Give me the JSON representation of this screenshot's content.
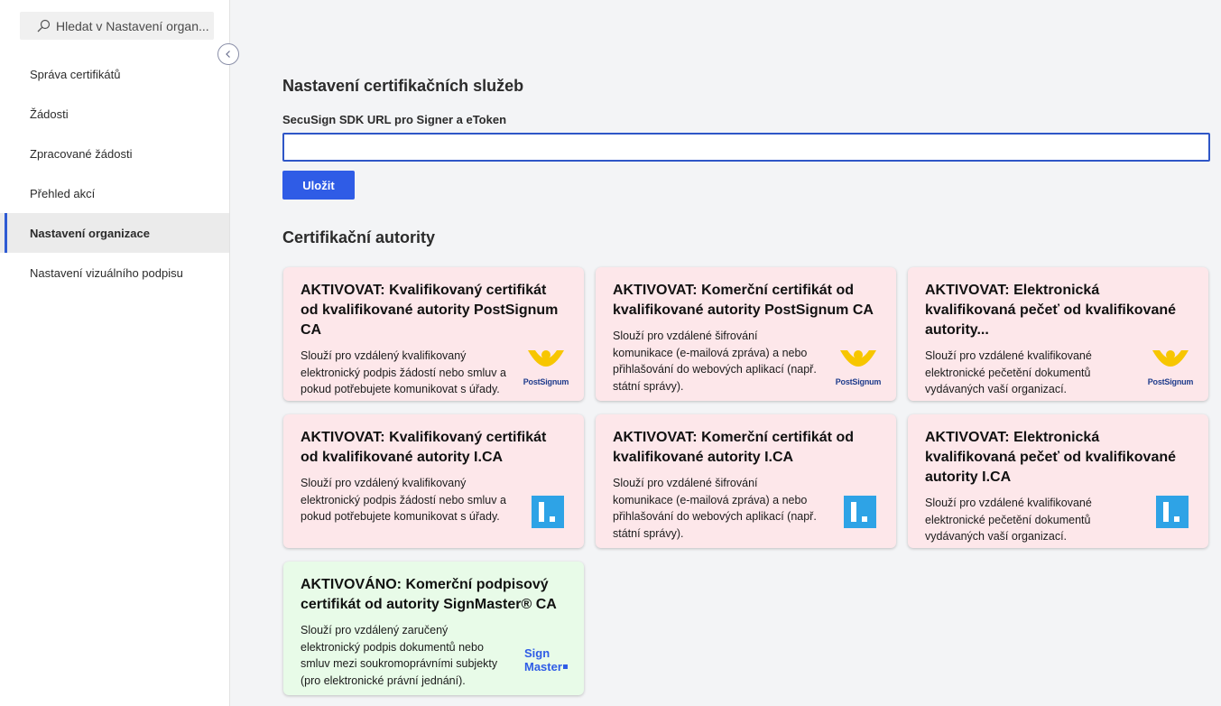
{
  "search": {
    "placeholder": "Hledat v Nastavení organ..."
  },
  "sidebar": {
    "items": [
      {
        "label": "Správa certifikátů"
      },
      {
        "label": "Žádosti"
      },
      {
        "label": "Zpracované žádosti"
      },
      {
        "label": "Přehled akcí"
      },
      {
        "label": "Nastavení organizace",
        "active": true
      },
      {
        "label": "Nastavení vizuálního podpisu"
      }
    ]
  },
  "main": {
    "services_title": "Nastavení certifikačních služeb",
    "url_label": "SecuSign SDK URL pro Signer a eToken",
    "url_value": "",
    "save_label": "Uložit",
    "authorities_title": "Certifikační autority"
  },
  "cards": [
    {
      "title": "AKTIVOVAT: Kvalifikovaný certifikát od kvalifikované autority PostSignum CA",
      "desc": "Slouží pro vzdálený kvalifikovaný elektronický podpis žádostí nebo smluv a pokud potřebujete komunikovat s úřady.",
      "logo": "PostSignum",
      "status": "inactive"
    },
    {
      "title": "AKTIVOVAT: Komerční certifikát od kvalifikované autority PostSignum CA",
      "desc": "Slouží pro vzdálené šifrování komunikace (e-mailová zpráva) a nebo přihlašování do webových aplikací (např. státní správy).",
      "logo": "PostSignum",
      "status": "inactive"
    },
    {
      "title": "AKTIVOVAT: Elektronická kvalifikovaná pečeť od kvalifikované autority...",
      "desc": "Slouží pro vzdálené kvalifikované elektronické pečetění dokumentů vydávaných vaší organizací.",
      "logo": "PostSignum",
      "status": "inactive"
    },
    {
      "title": "AKTIVOVAT: Kvalifikovaný certifikát od kvalifikované autority I.CA",
      "desc": "Slouží pro vzdálený kvalifikovaný elektronický podpis žádostí nebo smluv a pokud potřebujete komunikovat s úřady.",
      "logo": "I.CA",
      "status": "inactive"
    },
    {
      "title": "AKTIVOVAT: Komerční certifikát od kvalifikované autority I.CA",
      "desc": "Slouží pro vzdálené šifrování komunikace (e-mailová zpráva) a nebo přihlašování do webových aplikací (např. státní správy).",
      "logo": "I.CA",
      "status": "inactive"
    },
    {
      "title": "AKTIVOVAT: Elektronická kvalifikovaná pečeť od kvalifikované autority I.CA",
      "desc": "Slouží pro vzdálené kvalifikované elektronické pečetění dokumentů vydávaných vaší organizací.",
      "logo": "I.CA",
      "status": "inactive"
    },
    {
      "title": "AKTIVOVÁNO: Komerční podpisový certifikát od autority SignMaster® CA",
      "desc": "Slouží pro vzdálený zaručený elektronický podpis dokumentů nebo smluv mezi soukromoprávními subjekty (pro elektronické právní jednání).",
      "logo_line1": "Sign",
      "logo_line2": "Master",
      "status": "active"
    }
  ],
  "colors": {
    "accent": "#2f5ce6",
    "card_inactive": "#fde7ea",
    "card_active": "#e8fbe8",
    "postsignum_yellow": "#f7c600",
    "ica_blue": "#2ea3e6"
  },
  "icons": [
    "search-icon",
    "chevron-left-icon",
    "postsignum-logo",
    "ica-logo",
    "signmaster-logo"
  ]
}
